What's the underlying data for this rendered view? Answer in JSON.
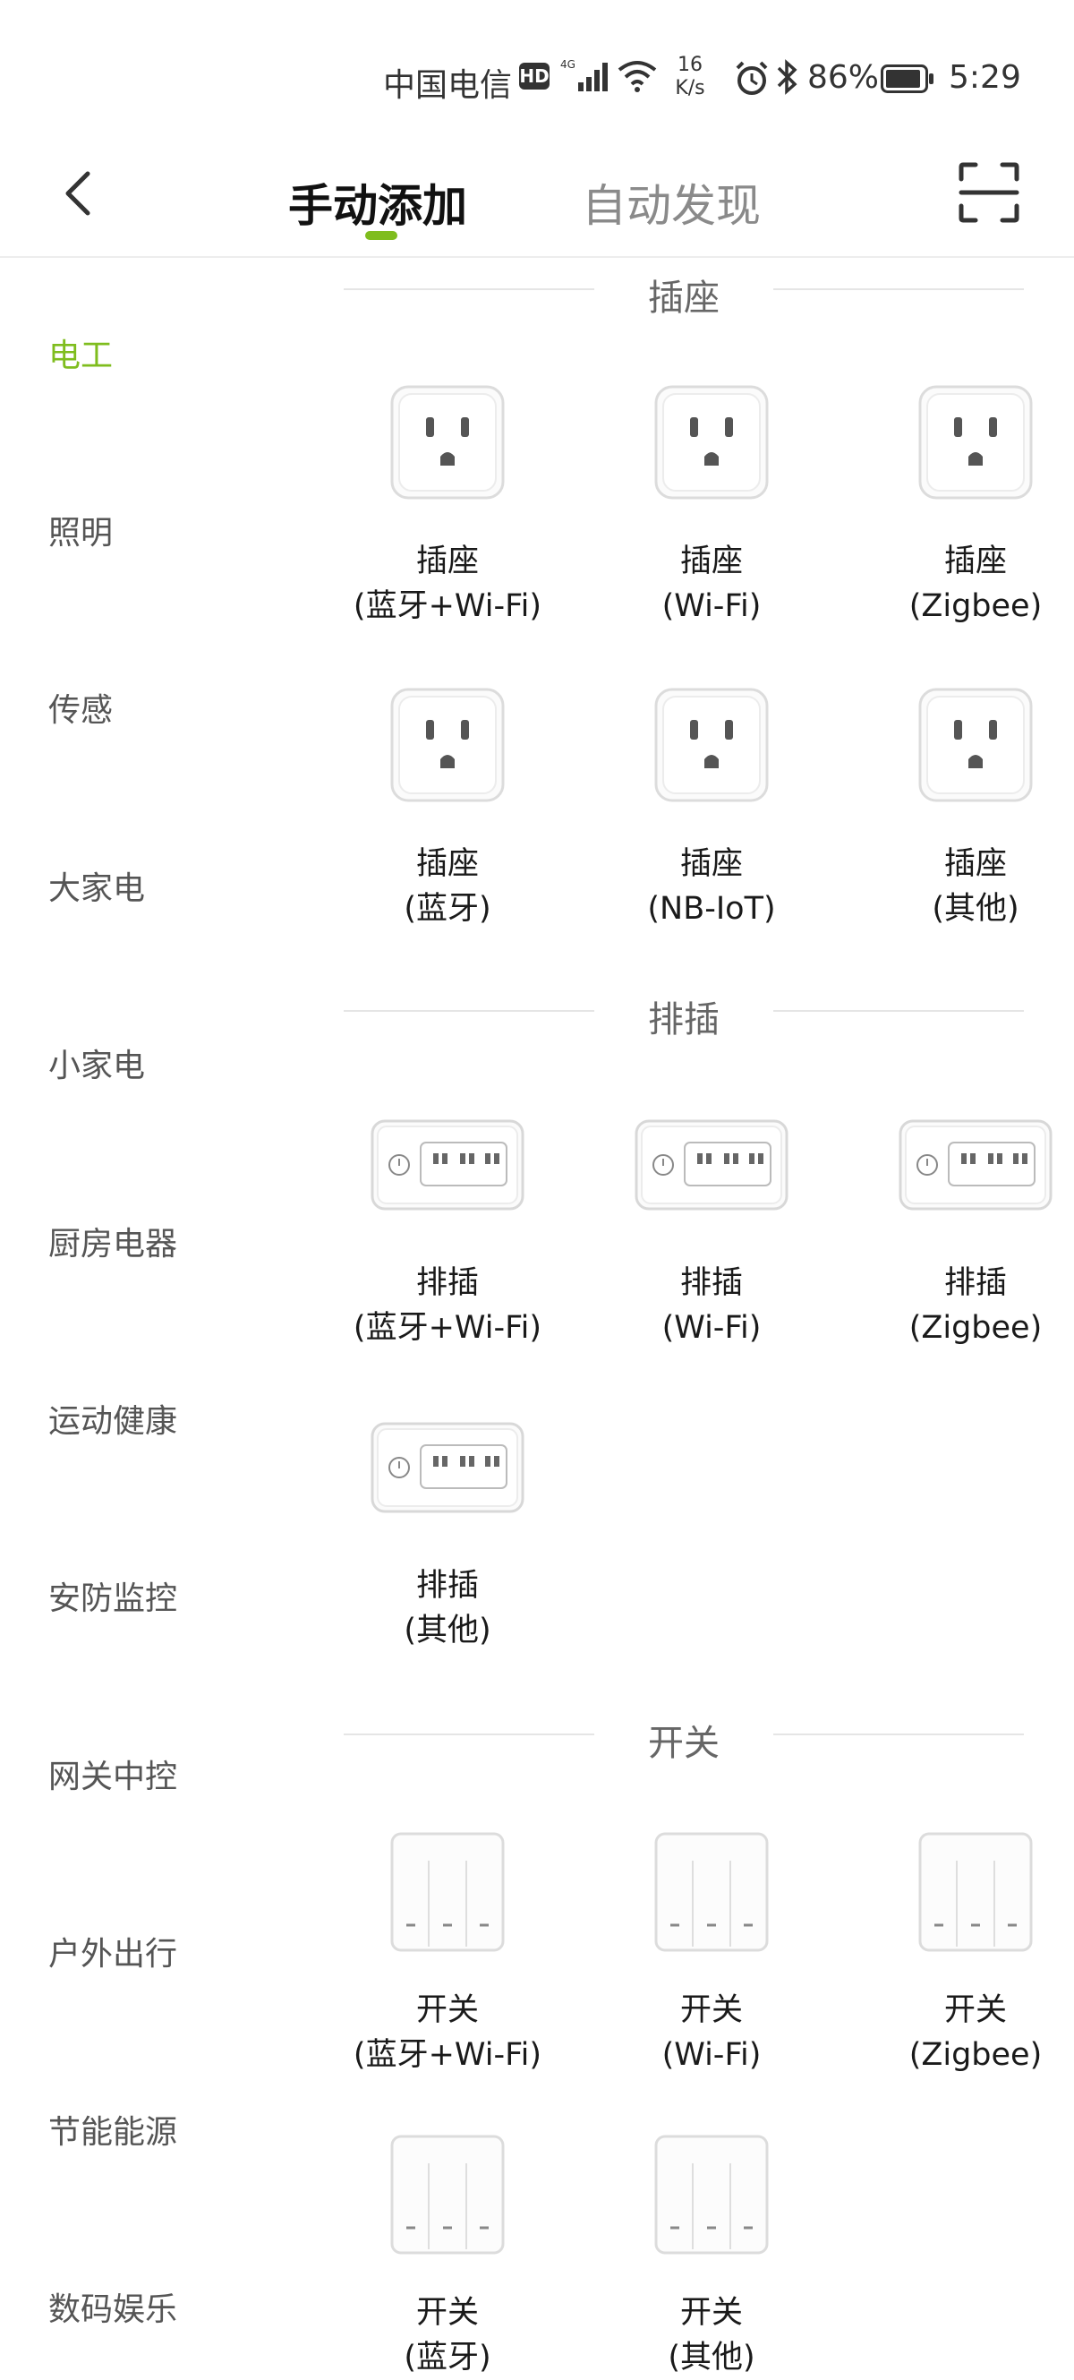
{
  "status_bar": {
    "carrier": "中国电信",
    "hd": "HD",
    "network": "4G",
    "speed_value": "16",
    "speed_unit": "K/s",
    "battery_percent": "86%",
    "time": "5:29",
    "icons": [
      "signal-icon",
      "wifi-icon",
      "alarm-icon",
      "bluetooth-icon",
      "battery-icon"
    ]
  },
  "header": {
    "tabs": [
      {
        "label": "手动添加",
        "active": true
      },
      {
        "label": "自动发现",
        "active": false
      }
    ],
    "accent_color": "#7fbd1e"
  },
  "sidebar": {
    "items": [
      {
        "label": "电工",
        "active": true
      },
      {
        "label": "照明"
      },
      {
        "label": "传感"
      },
      {
        "label": "大家电"
      },
      {
        "label": "小家电"
      },
      {
        "label": "厨房电器"
      },
      {
        "label": "运动健康"
      },
      {
        "label": "安防监控"
      },
      {
        "label": "网关中控"
      },
      {
        "label": "户外出行"
      },
      {
        "label": "节能能源"
      },
      {
        "label": "数码娱乐"
      }
    ]
  },
  "sections": [
    {
      "title": "插座",
      "icon": "socket-icon",
      "devices": [
        {
          "name": "插座",
          "protocol": "(蓝牙+Wi-Fi)"
        },
        {
          "name": "插座",
          "protocol": "(Wi-Fi)"
        },
        {
          "name": "插座",
          "protocol": "(Zigbee)"
        },
        {
          "name": "插座",
          "protocol": "(蓝牙)"
        },
        {
          "name": "插座",
          "protocol": "(NB-IoT)"
        },
        {
          "name": "插座",
          "protocol": "(其他)"
        }
      ]
    },
    {
      "title": "排插",
      "icon": "power-strip-icon",
      "devices": [
        {
          "name": "排插",
          "protocol": "(蓝牙+Wi-Fi)"
        },
        {
          "name": "排插",
          "protocol": "(Wi-Fi)"
        },
        {
          "name": "排插",
          "protocol": "(Zigbee)"
        },
        {
          "name": "排插",
          "protocol": "(其他)"
        }
      ]
    },
    {
      "title": "开关",
      "icon": "wall-switch-icon",
      "devices": [
        {
          "name": "开关",
          "protocol": "(蓝牙+Wi-Fi)"
        },
        {
          "name": "开关",
          "protocol": "(Wi-Fi)"
        },
        {
          "name": "开关",
          "protocol": "(Zigbee)"
        },
        {
          "name": "开关",
          "protocol": "(蓝牙)"
        },
        {
          "name": "开关",
          "protocol": "(其他)"
        }
      ]
    }
  ]
}
